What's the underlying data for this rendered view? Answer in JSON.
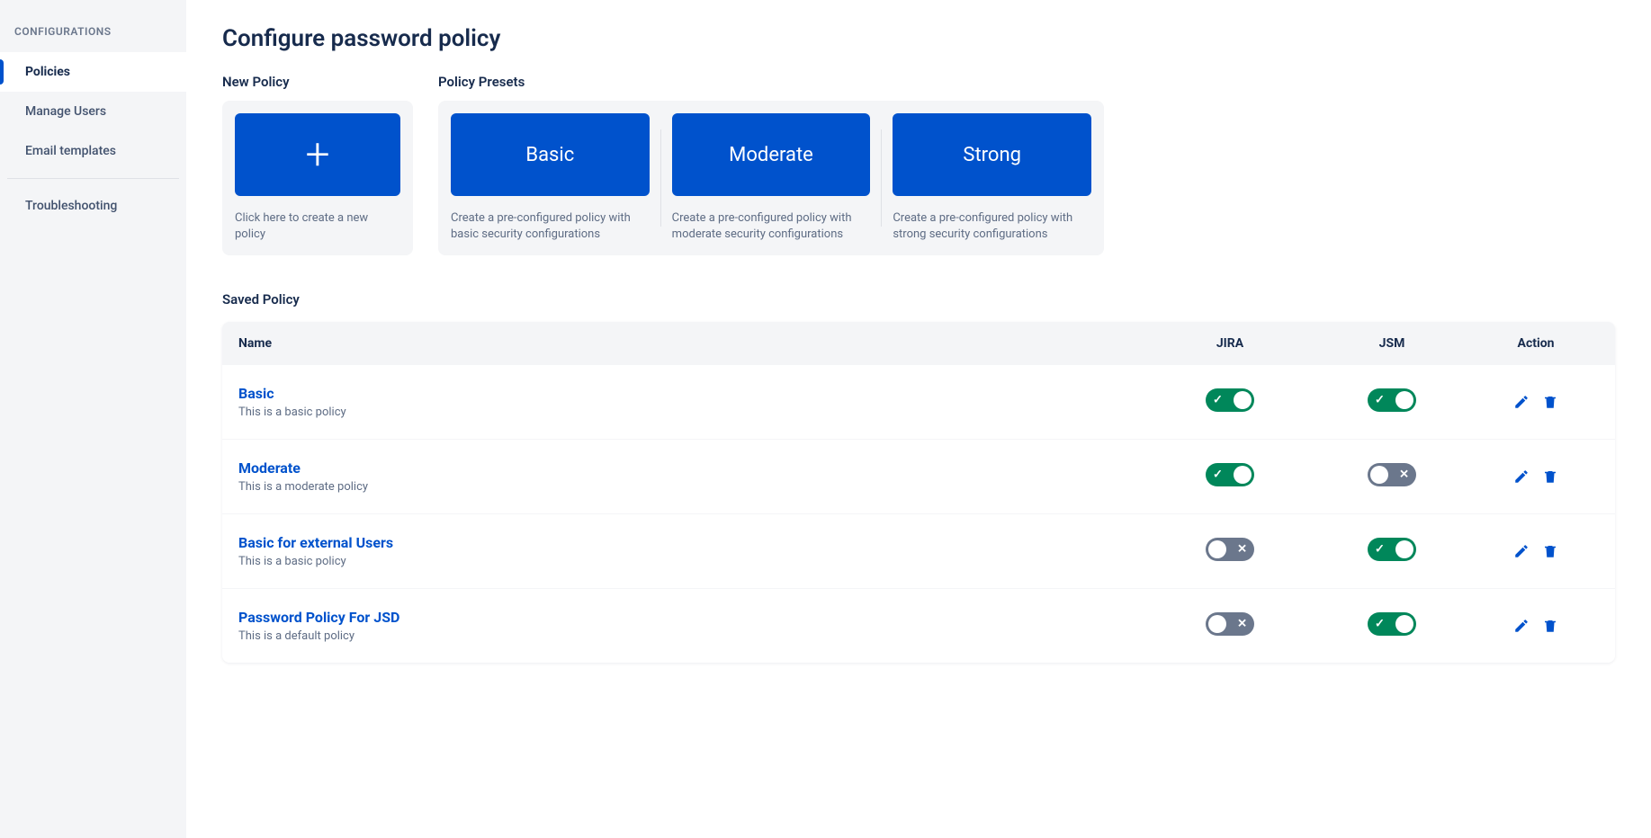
{
  "sidebar": {
    "header": "CONFIGURATIONS",
    "items": [
      {
        "label": "Policies",
        "active": true
      },
      {
        "label": "Manage Users",
        "active": false
      },
      {
        "label": "Email templates",
        "active": false
      }
    ],
    "footer_items": [
      {
        "label": "Troubleshooting",
        "active": false
      }
    ]
  },
  "page": {
    "title": "Configure password policy",
    "new_policy_label": "New Policy",
    "new_policy_desc": "Click here to create a new policy",
    "presets_label": "Policy Presets",
    "presets": [
      {
        "name": "Basic",
        "desc": "Create a pre-configured policy with basic security configurations"
      },
      {
        "name": "Moderate",
        "desc": "Create a pre-configured policy with moderate security configurations"
      },
      {
        "name": "Strong",
        "desc": "Create a pre-configured policy with strong security configurations"
      }
    ],
    "saved_label": "Saved Policy",
    "table": {
      "headers": {
        "name": "Name",
        "jira": "JIRA",
        "jsm": "JSM",
        "action": "Action"
      },
      "rows": [
        {
          "name": "Basic",
          "desc": "This is a basic policy",
          "jira": true,
          "jsm": true
        },
        {
          "name": "Moderate",
          "desc": "This is a moderate policy",
          "jira": true,
          "jsm": false
        },
        {
          "name": "Basic for external Users",
          "desc": "This is a basic policy",
          "jira": false,
          "jsm": true
        },
        {
          "name": "Password Policy For JSD",
          "desc": "This is a default policy",
          "jira": false,
          "jsm": true
        }
      ]
    }
  }
}
